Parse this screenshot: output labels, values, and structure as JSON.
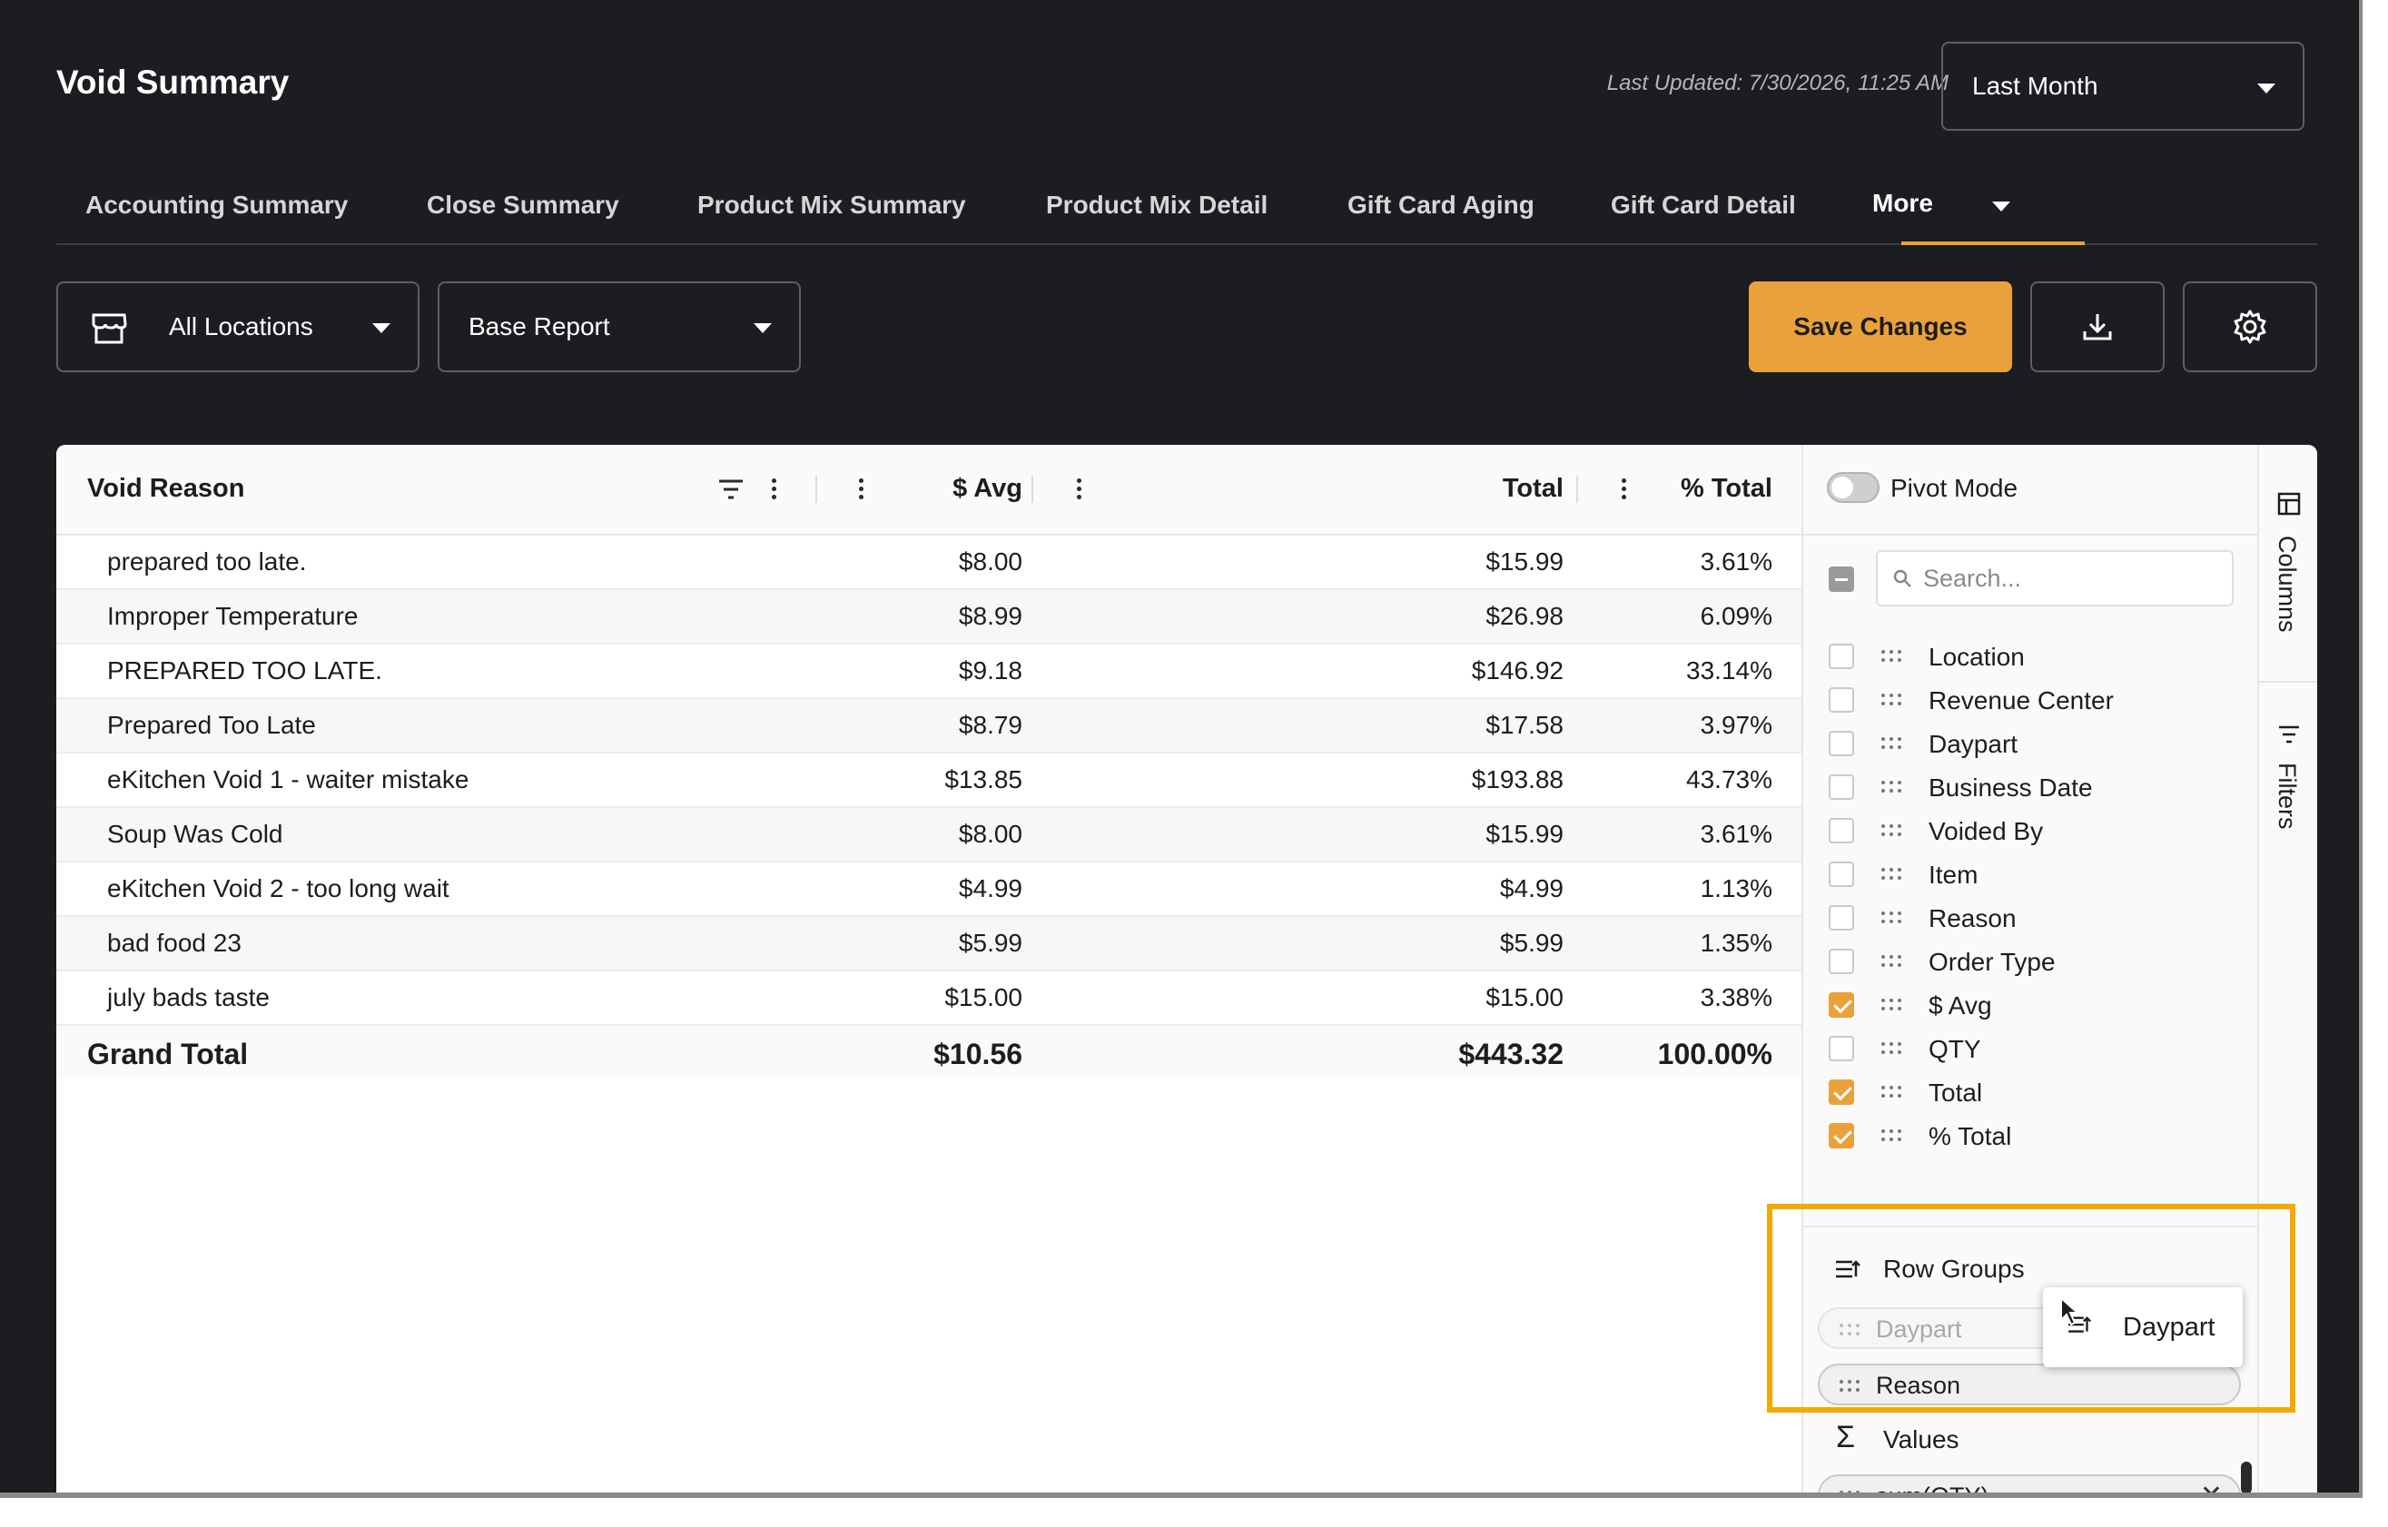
{
  "header": {
    "title": "Void Summary",
    "last_updated": "Last Updated: 7/30/2026, 11:25 AM",
    "date_range": "Last Month"
  },
  "tabs": [
    {
      "label": "Accounting Summary"
    },
    {
      "label": "Close Summary"
    },
    {
      "label": "Product Mix Summary"
    },
    {
      "label": "Product Mix Detail"
    },
    {
      "label": "Gift Card Aging"
    },
    {
      "label": "Gift Card Detail"
    },
    {
      "label": "More"
    }
  ],
  "toolbar": {
    "locations": "All Locations",
    "report": "Base Report",
    "save_label": "Save Changes"
  },
  "grid": {
    "columns": [
      "Void Reason",
      "$ Avg",
      "Total",
      "% Total"
    ],
    "rows": [
      [
        "prepared too late.",
        "$8.00",
        "$15.99",
        "3.61%"
      ],
      [
        "Improper Temperature",
        "$8.99",
        "$26.98",
        "6.09%"
      ],
      [
        "PREPARED TOO LATE.",
        "$9.18",
        "$146.92",
        "33.14%"
      ],
      [
        "Prepared Too Late",
        "$8.79",
        "$17.58",
        "3.97%"
      ],
      [
        "eKitchen Void 1 - waiter mistake",
        "$13.85",
        "$193.88",
        "43.73%"
      ],
      [
        "Soup Was Cold",
        "$8.00",
        "$15.99",
        "3.61%"
      ],
      [
        "eKitchen Void 2 - too long wait",
        "$4.99",
        "$4.99",
        "1.13%"
      ],
      [
        "bad food 23",
        "$5.99",
        "$5.99",
        "1.35%"
      ],
      [
        "july bads taste",
        "$15.00",
        "$15.00",
        "3.38%"
      ]
    ],
    "grand_total": [
      "Grand Total",
      "$10.56",
      "$443.32",
      "100.00%"
    ]
  },
  "sidepanel": {
    "pivot_mode": "Pivot Mode",
    "search_placeholder": "Search...",
    "columns": [
      {
        "label": "Location",
        "checked": false
      },
      {
        "label": "Revenue Center",
        "checked": false
      },
      {
        "label": "Daypart",
        "checked": false
      },
      {
        "label": "Business Date",
        "checked": false
      },
      {
        "label": "Voided By",
        "checked": false
      },
      {
        "label": "Item",
        "checked": false
      },
      {
        "label": "Reason",
        "checked": false
      },
      {
        "label": "Order Type",
        "checked": false
      },
      {
        "label": "$ Avg",
        "checked": true
      },
      {
        "label": "QTY",
        "checked": false
      },
      {
        "label": "Total",
        "checked": true
      },
      {
        "label": "% Total",
        "checked": true
      }
    ],
    "row_groups_title": "Row Groups",
    "row_groups": [
      "Daypart",
      "Reason"
    ],
    "values_title": "Values",
    "values": [
      "sum(QTY)"
    ],
    "drag_label": "Daypart"
  },
  "vtabs": {
    "columns": "Columns",
    "filters": "Filters"
  },
  "colors": {
    "accent": "#e9a23b",
    "highlight": "#f2a900",
    "background": "#1b1d21"
  }
}
